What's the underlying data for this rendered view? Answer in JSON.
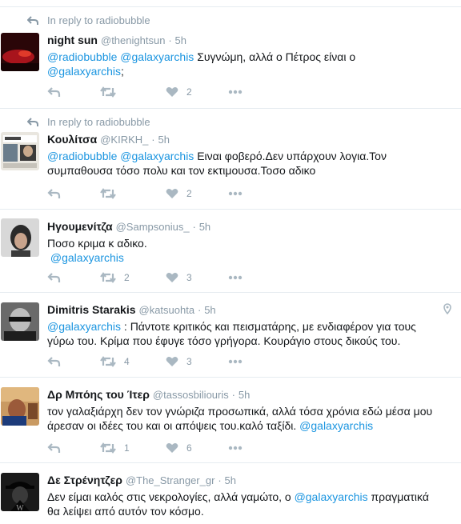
{
  "reply_prefix": "In reply to",
  "time_sep": "·",
  "tweets": [
    {
      "reply_to": "radiobubble",
      "name": "night sun",
      "handle": "@thenightsun",
      "time": "5h",
      "mentions": [
        "@radiobubble",
        "@galaxyarchis"
      ],
      "text": "Συγνώμη, αλλά ο Πέτρος είναι ο",
      "tail_mention": "@galaxyarchis",
      "tail_text": ";",
      "retweets": "",
      "likes": "2"
    },
    {
      "reply_to": "radiobubble",
      "name": "Κουλίτσα",
      "handle": "@KIRKH_",
      "time": "5h",
      "mentions": [
        "@radiobubble",
        "@galaxyarchis"
      ],
      "text": "Ειναι φοβερό.Δεν υπάρχουν λογια.Τον",
      "text2": "συμπαθουσα τόσο πολυ και τον εκτιμουσα.Τοσο αδικο",
      "retweets": "",
      "likes": "2"
    },
    {
      "name": "Ηγουμενίτζα",
      "handle": "@Sampsonius_",
      "time": "5h",
      "text": "Ποσο κριμα κ αδικο.",
      "mention_line": "@galaxyarchis",
      "retweets": "2",
      "likes": "3"
    },
    {
      "name": "Dimitris Starakis",
      "handle": "@katsuohta",
      "time": "5h",
      "mention": "@galaxyarchis",
      "text": ": Πάντοτε κριτικός και πεισματάρης, με ενδιαφέρον για τους",
      "text2": "γύρω του. Κρίμα που έφυγε τόσο γρήγορα. Κουράγιο στους δικούς του.",
      "retweets": "4",
      "likes": "3"
    },
    {
      "name": "Δρ Μπόης του Ίτερ",
      "handle": "@tassosbiliouris",
      "time": "5h",
      "text": "τον γαλαξιάρχη δεν τον γνώριζα προσωπικά, αλλά τόσα χρόνια εδώ μέσα μου",
      "text2": "άρεσαν οι ιδέες του και οι απόψεις του.καλό ταξίδι.",
      "tail_mention": "@galaxyarchis",
      "retweets": "1",
      "likes": "6"
    },
    {
      "name": "Δε Στρένητζερ",
      "handle": "@The_Stranger_gr",
      "time": "5h",
      "text": "Δεν είμαι καλός στις νεκρολογίες, αλλά γαμώτο, ο",
      "inline_mention": "@galaxyarchis",
      "text_after": "πραγματικά",
      "text2": "θα λείψει από αυτόν τον κόσμο."
    }
  ],
  "icons": {
    "reply": "reply-icon",
    "retweet": "retweet-icon",
    "like": "heart-icon",
    "more": "more-icon",
    "location": "location-pin-icon"
  },
  "colors": {
    "link": "#1b95e0",
    "muted": "#8899a6",
    "icon": "#aab8c2",
    "divider": "#e6ecf0"
  }
}
